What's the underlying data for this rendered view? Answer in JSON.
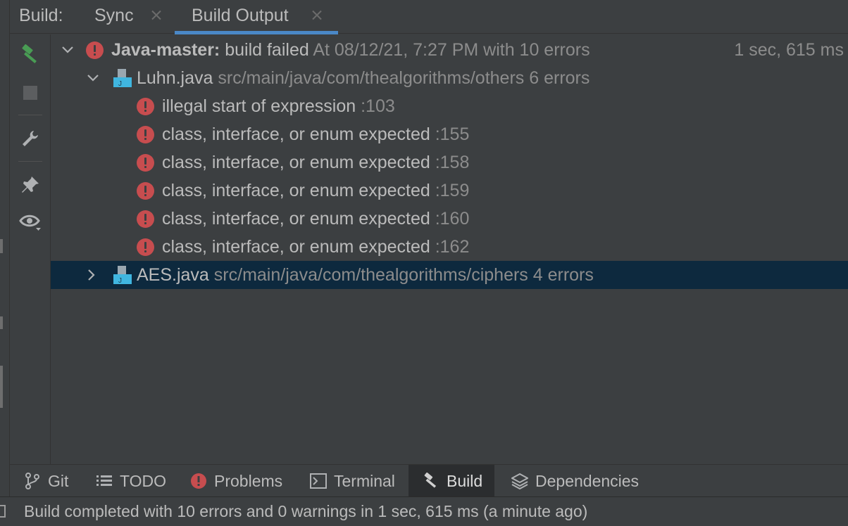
{
  "header": {
    "label": "Build:",
    "tabs": [
      {
        "label": "Sync",
        "active": false
      },
      {
        "label": "Build Output",
        "active": true
      }
    ]
  },
  "toolbar": {
    "icons": [
      "hammer-icon",
      "stop-icon",
      "wrench-icon",
      "pin-icon",
      "eye-icon"
    ],
    "accent_color": "#499c54"
  },
  "tree": {
    "root": {
      "project": "Java-master:",
      "status": "build failed",
      "detail": "At 08/12/21, 7:27 PM with 10 errors",
      "duration": "1 sec, 615 ms"
    },
    "files": [
      {
        "name": "Luhn.java",
        "path": "src/main/java/com/thealgorithms/others",
        "count": "6 errors",
        "expanded": true,
        "errors": [
          {
            "message": "illegal start of expression",
            "line": ":103"
          },
          {
            "message": "class, interface, or enum expected",
            "line": ":155"
          },
          {
            "message": "class, interface, or enum expected",
            "line": ":158"
          },
          {
            "message": "class, interface, or enum expected",
            "line": ":159"
          },
          {
            "message": "class, interface, or enum expected",
            "line": ":160"
          },
          {
            "message": "class, interface, or enum expected",
            "line": ":162"
          }
        ]
      },
      {
        "name": "AES.java",
        "path": "src/main/java/com/thealgorithms/ciphers",
        "count": "4 errors",
        "expanded": false,
        "selected": true
      }
    ],
    "error_color": "#c74d4f",
    "selection_color": "#0d293e"
  },
  "bottombar": {
    "items": [
      {
        "label": "Git",
        "icon": "git-branch-icon"
      },
      {
        "label": "TODO",
        "icon": "list-icon"
      },
      {
        "label": "Problems",
        "icon": "error-icon"
      },
      {
        "label": "Terminal",
        "icon": "terminal-icon"
      },
      {
        "label": "Build",
        "icon": "hammer-icon",
        "active": true
      },
      {
        "label": "Dependencies",
        "icon": "layers-icon"
      }
    ]
  },
  "statusbar": {
    "text": "Build completed with 10 errors and 0 warnings in 1 sec, 615 ms (a minute ago)"
  }
}
